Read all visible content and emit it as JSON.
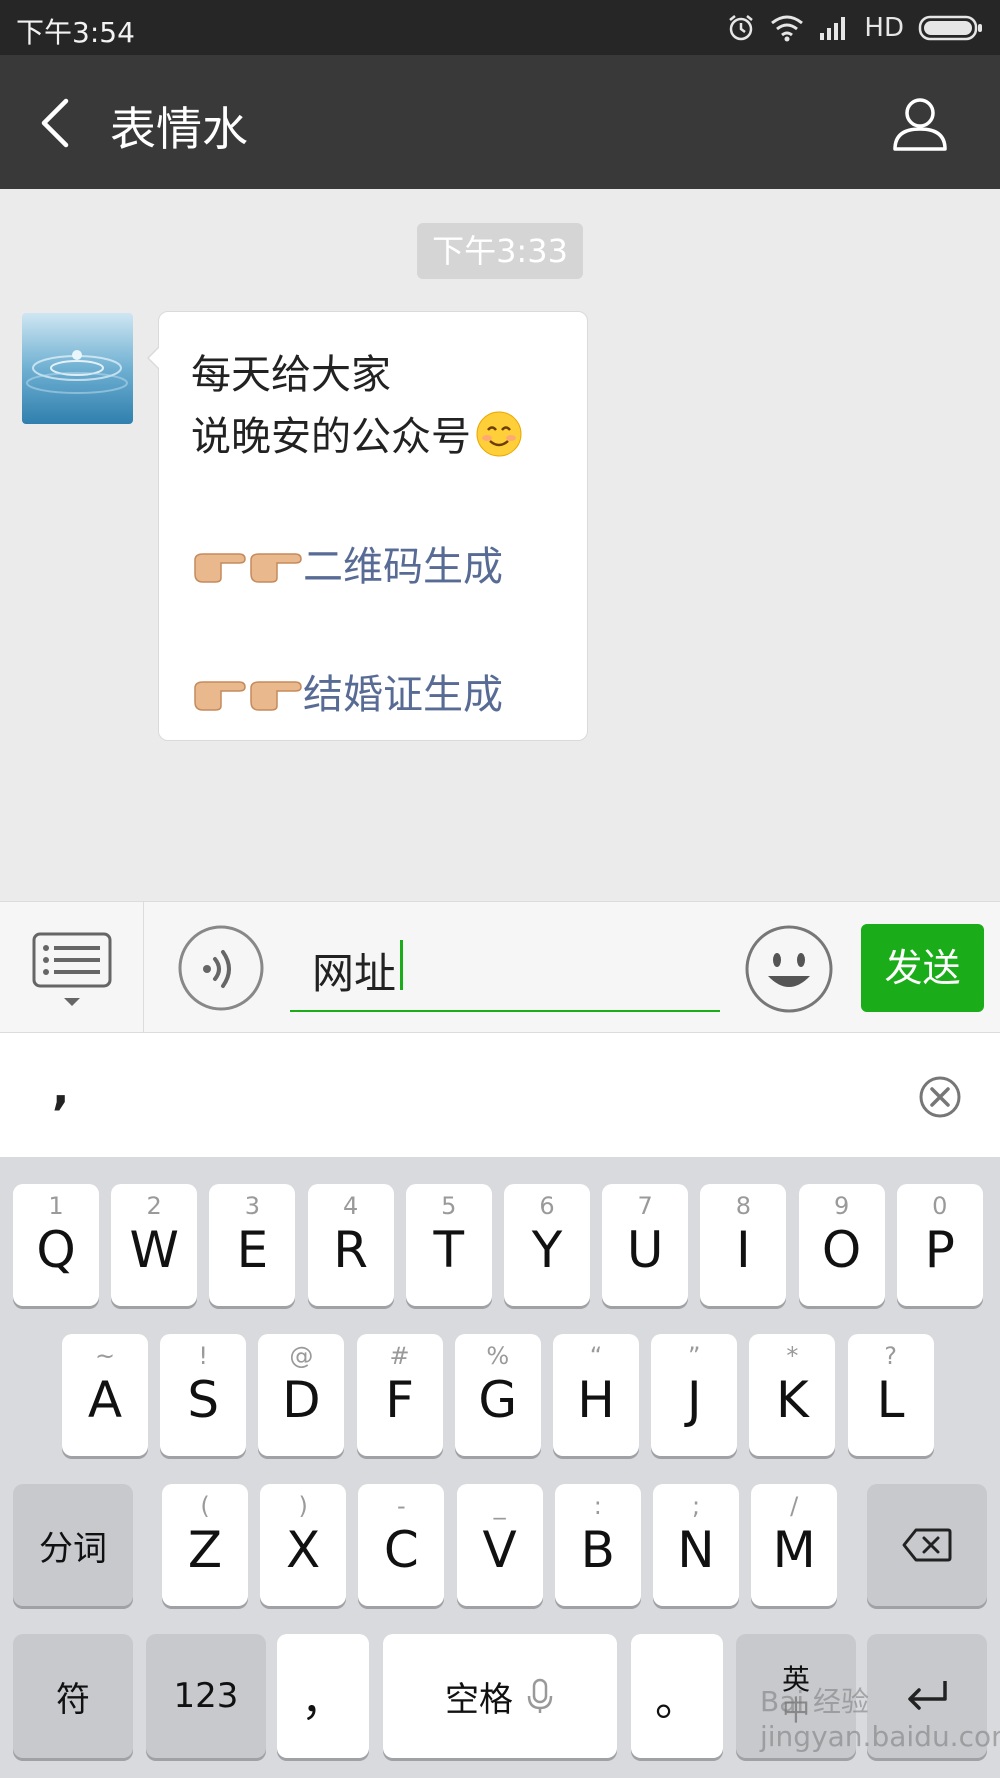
{
  "status_bar": {
    "time": "下午3:54",
    "network": "HD"
  },
  "nav": {
    "title": "表情水"
  },
  "chat": {
    "timestamp": "下午3:33",
    "message": {
      "line1": "每天给大家",
      "line2": "说晚安的公众号",
      "link1": "二维码生成",
      "link2": "结婚证生成"
    }
  },
  "input": {
    "text": "网址",
    "send_label": "发送"
  },
  "candidates": {
    "first": ","
  },
  "keyboard": {
    "row1": [
      {
        "main": "Q",
        "sub": "1"
      },
      {
        "main": "W",
        "sub": "2"
      },
      {
        "main": "E",
        "sub": "3"
      },
      {
        "main": "R",
        "sub": "4"
      },
      {
        "main": "T",
        "sub": "5"
      },
      {
        "main": "Y",
        "sub": "6"
      },
      {
        "main": "U",
        "sub": "7"
      },
      {
        "main": "I",
        "sub": "8"
      },
      {
        "main": "O",
        "sub": "9"
      },
      {
        "main": "P",
        "sub": "0"
      }
    ],
    "row2": [
      {
        "main": "A",
        "sub": "~"
      },
      {
        "main": "S",
        "sub": "!"
      },
      {
        "main": "D",
        "sub": "@"
      },
      {
        "main": "F",
        "sub": "#"
      },
      {
        "main": "G",
        "sub": "%"
      },
      {
        "main": "H",
        "sub": "“"
      },
      {
        "main": "J",
        "sub": "”"
      },
      {
        "main": "K",
        "sub": "*"
      },
      {
        "main": "L",
        "sub": "?"
      }
    ],
    "row3": [
      {
        "main": "Z",
        "sub": "("
      },
      {
        "main": "X",
        "sub": ")"
      },
      {
        "main": "C",
        "sub": "-"
      },
      {
        "main": "V",
        "sub": "_"
      },
      {
        "main": "B",
        "sub": ":"
      },
      {
        "main": "N",
        "sub": ";"
      },
      {
        "main": "M",
        "sub": "/"
      }
    ],
    "fenci": "分词",
    "symbol": "符",
    "num": "123",
    "comma": "，",
    "space": "空格",
    "period": "。",
    "lang": "英",
    "lang_sub": "中"
  },
  "watermark": "Bai 经验 jingyan.baidu.com"
}
